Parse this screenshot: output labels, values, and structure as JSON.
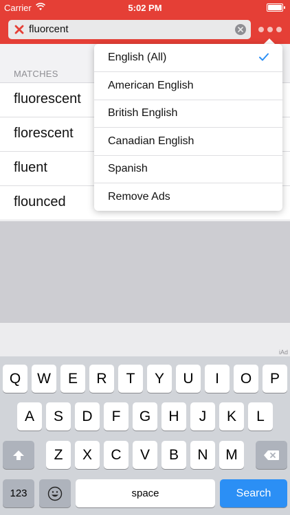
{
  "status_bar": {
    "carrier": "Carrier",
    "time": "5:02 PM"
  },
  "search": {
    "value": "fluorcent"
  },
  "results": {
    "section_header": "MATCHES",
    "items": [
      "fluorescent",
      "florescent",
      "fluent",
      "flounced"
    ]
  },
  "dropdown": {
    "items": [
      {
        "label": "English (All)",
        "selected": true
      },
      {
        "label": "American English"
      },
      {
        "label": "British English"
      },
      {
        "label": "Canadian English"
      },
      {
        "label": "Spanish"
      },
      {
        "label": "Remove Ads"
      }
    ]
  },
  "ad": {
    "label": "iAd"
  },
  "keyboard": {
    "row1": [
      "Q",
      "W",
      "E",
      "R",
      "T",
      "Y",
      "U",
      "I",
      "O",
      "P"
    ],
    "row2": [
      "A",
      "S",
      "D",
      "F",
      "G",
      "H",
      "J",
      "K",
      "L"
    ],
    "row3": [
      "Z",
      "X",
      "C",
      "V",
      "B",
      "N",
      "M"
    ],
    "numbers_label": "123",
    "space_label": "space",
    "search_label": "Search"
  },
  "colors": {
    "header": "#e53f36",
    "accent": "#2b8ff5",
    "clear_x": "#e53f36"
  },
  "icons": {
    "wifi": "wifi-icon",
    "battery": "battery-icon",
    "clear_search": "clear-x-icon",
    "clear_text": "clear-circle-icon",
    "more": "more-dots-icon",
    "check": "checkmark-icon",
    "shift": "shift-icon",
    "delete": "backspace-icon",
    "emoji": "emoji-icon"
  }
}
